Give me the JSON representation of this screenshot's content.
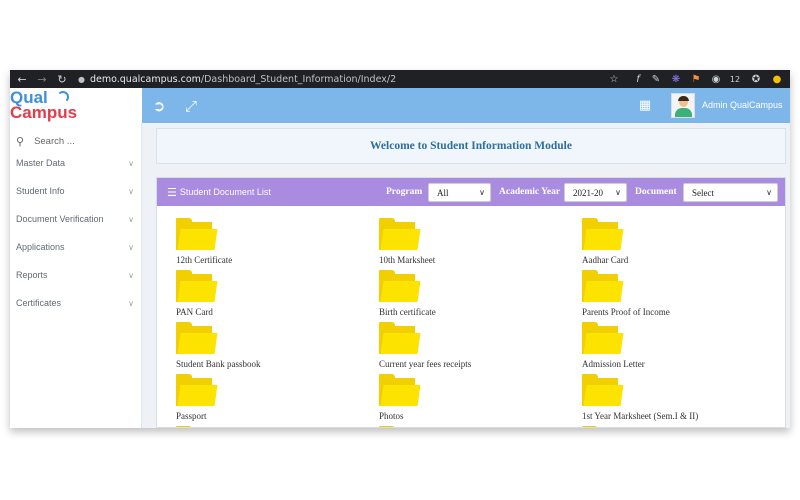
{
  "browser": {
    "url_host": "demo.qualcampus.com",
    "url_path": "/Dashboard_Student_Information/Index/2",
    "badge_count": "12"
  },
  "logo": {
    "line1": "Qual",
    "line2": "Campus"
  },
  "header": {
    "user_name": "Admin QualCampus"
  },
  "sidebar": {
    "search_placeholder": "Search ...",
    "items": [
      {
        "label": "Master Data"
      },
      {
        "label": "Student Info"
      },
      {
        "label": "Document Verification"
      },
      {
        "label": "Applications"
      },
      {
        "label": "Reports"
      },
      {
        "label": "Certificates"
      }
    ]
  },
  "welcome": {
    "text": "Welcome to Student Information Module"
  },
  "panel": {
    "title": "Student Document List",
    "filters": {
      "program_label": "Program",
      "program_value": "All",
      "year_label": "Academic Year",
      "year_value": "2021-20",
      "document_label": "Document",
      "document_value": "Select"
    },
    "documents": [
      {
        "name": "12th Certificate"
      },
      {
        "name": "10th Marksheet"
      },
      {
        "name": "Aadhar Card"
      },
      {
        "name": "PAN Card"
      },
      {
        "name": "Birth certificate"
      },
      {
        "name": "Parents Proof of Income"
      },
      {
        "name": "Student Bank passbook"
      },
      {
        "name": "Current year fees receipts"
      },
      {
        "name": "Admission Letter"
      },
      {
        "name": "Passport"
      },
      {
        "name": "Photos"
      },
      {
        "name": "1st Year Marksheet (Sem.I & II)"
      }
    ]
  },
  "colors": {
    "header": "#7db6e8",
    "panel_header": "#a98be0",
    "folder": "#fde300",
    "logo_blue": "#3d8fe0",
    "logo_red": "#e53b4a"
  }
}
